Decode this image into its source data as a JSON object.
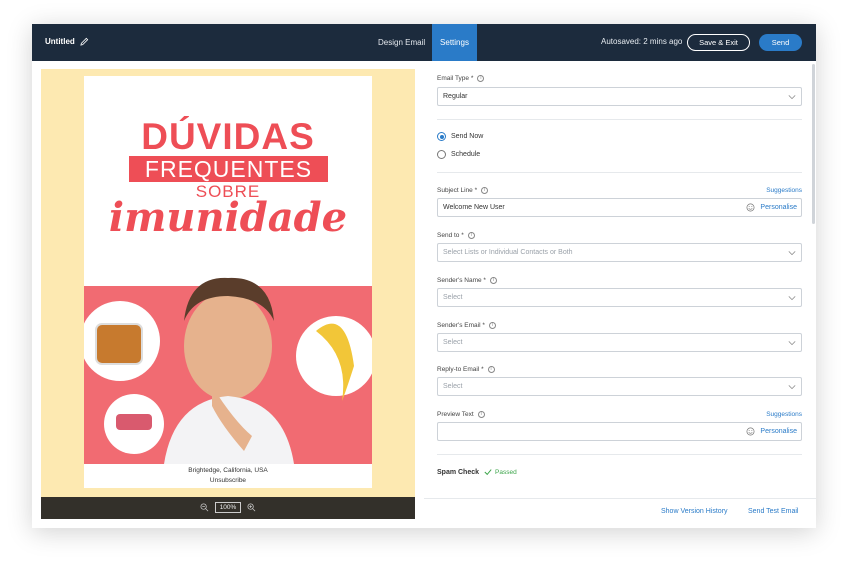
{
  "header": {
    "title": "Untitled",
    "tabs": [
      {
        "label": "Design Email"
      },
      {
        "label": "Settings"
      }
    ],
    "active_tab": "Settings",
    "autosave": "Autosaved: 2 mins ago",
    "save_exit_label": "Save & Exit",
    "send_label": "Send",
    "accent_color": "#2a7bc8",
    "bar_color": "#1c2b3d"
  },
  "preview": {
    "headline_1": "DÚVIDAS",
    "headline_2": "FREQUENTES",
    "headline_3": "SOBRE",
    "headline_4": "imunidade",
    "footer_address": "Brightedge, California, USA",
    "footer_unsubscribe": "Unsubscribe",
    "zoom": "100%"
  },
  "form": {
    "email_type": {
      "label": "Email Type *",
      "value": "Regular"
    },
    "send_options": [
      {
        "label": "Send Now",
        "selected": true
      },
      {
        "label": "Schedule",
        "selected": false
      }
    ],
    "subject_line": {
      "label": "Subject Line *",
      "value": "Welcome New User",
      "suggestions": "Suggestions",
      "personalise": "Personalise"
    },
    "send_to": {
      "label": "Send to *",
      "placeholder": "Select Lists or Individual Contacts or Both"
    },
    "senders_name": {
      "label": "Sender's Name *",
      "placeholder": "Select"
    },
    "senders_email": {
      "label": "Sender's Email *",
      "placeholder": "Select"
    },
    "reply_to": {
      "label": "Reply-to Email *",
      "placeholder": "Select"
    },
    "preview_text": {
      "label": "Preview Text",
      "value": "",
      "suggestions": "Suggestions",
      "personalise": "Personalise"
    },
    "spam_check": {
      "label": "Spam Check",
      "status": "Passed"
    }
  },
  "footer": {
    "version_history": "Show Version History",
    "send_test": "Send Test Email"
  }
}
